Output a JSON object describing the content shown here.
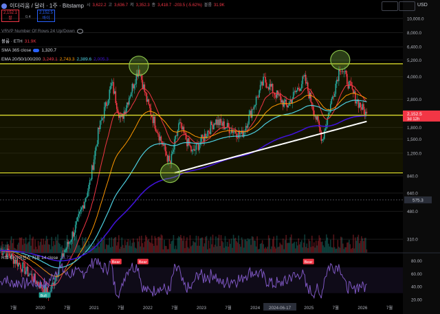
{
  "header": {
    "title": "이더리움 / 달러 · 1주 · Bitstamp",
    "ohlc": [
      {
        "k": "시",
        "v": "3,622.2"
      },
      {
        "k": "고",
        "v": "3,636.7"
      },
      {
        "k": "저",
        "v": "3,352.3"
      },
      {
        "k": "종",
        "v": "3,418.7"
      },
      {
        "k": "",
        "v": "-203.5 (-5.62%)"
      },
      {
        "k": "볼륨",
        "v": "31.9K"
      }
    ],
    "sell": {
      "price": "2,152.1",
      "label": "팔"
    },
    "spread": "0.4",
    "buy": {
      "price": "2,152.5",
      "label": "바이"
    },
    "currency": "USD"
  },
  "indicators": [
    {
      "name": "VRVP Number Of Rows 24 Up/Down",
      "values": []
    },
    {
      "name": "볼륨 · ETH",
      "values": [
        "31.9K"
      ]
    },
    {
      "name": "SMA 365 close",
      "values": [
        "1,320.7"
      ]
    },
    {
      "name": "EMA 20/50/100/200",
      "values": [
        "3,249.1",
        "2,743.3",
        "2,389.6",
        "2,005.3"
      ]
    }
  ],
  "colors": {
    "up": "#26a69a",
    "down": "#f23645",
    "ema20": "#f23645",
    "ema50": "#ff9800",
    "ema100": "#4dd0e1",
    "ema200": "#3f12d6",
    "sma365": "#ffffff",
    "channel": "#d6d62a",
    "rsi": "#7e57c2"
  },
  "chart_data": [
    {
      "type": "line",
      "title": "이더리움 / 달러 · 1주 · Bitstamp",
      "y_scale": "log",
      "ylim": [
        250,
        11000
      ],
      "y_ticks": [
        "10,000.0",
        "8,000.0",
        "6,400.0",
        "5,200.0",
        "4,000.0",
        "2,800.0",
        "2,200.0",
        "1,800.0",
        "1,500.0",
        "1,200.0",
        "840.0",
        "640.0",
        "480.0",
        "310.0"
      ],
      "x_ticks": [
        "7월",
        "2020",
        "7월",
        "2021",
        "7월",
        "2022",
        "7월",
        "2023",
        "7월",
        "2024",
        "2024-06-17",
        "2025",
        "7월",
        "2026",
        "7월"
      ],
      "price_path": [
        [
          "2019-05",
          260
        ],
        [
          "2019-09",
          200
        ],
        [
          "2020-03",
          130
        ],
        [
          "2020-06",
          240
        ],
        [
          "2020-09",
          380
        ],
        [
          "2020-12",
          730
        ],
        [
          "2021-02",
          1700
        ],
        [
          "2021-05",
          3600
        ],
        [
          "2021-07",
          2000
        ],
        [
          "2021-11",
          4600
        ],
        [
          "2022-01",
          2600
        ],
        [
          "2022-06",
          1000
        ],
        [
          "2022-08",
          1900
        ],
        [
          "2022-11",
          1200
        ],
        [
          "2023-04",
          2000
        ],
        [
          "2023-10",
          1600
        ],
        [
          "2024-03",
          3800
        ],
        [
          "2024-08",
          2500
        ],
        [
          "2024-12",
          3900
        ],
        [
          "2025-04",
          1500
        ],
        [
          "2025-08",
          4800
        ],
        [
          "2025-11",
          3000
        ],
        [
          "2026-02",
          2152.5
        ]
      ],
      "ema20_last": 3249.1,
      "ema50_last": 2743.3,
      "ema100_last": 2389.6,
      "ema200_last": 2005.3,
      "sma365_last": 1320.7,
      "channel_lines": [
        4900,
        2180,
        880
      ],
      "price_labels": [
        "2,152.5",
        "3d 12h",
        "575.3"
      ],
      "annotations": [
        "circle top 2021",
        "circle top 2025",
        "circle bottom 2022"
      ]
    },
    {
      "type": "line",
      "title": "RSI 다이버전스 지표 14 close",
      "values_last": "36.72",
      "ylim": [
        20,
        85
      ],
      "y_ticks": [
        "80.00",
        "60.00",
        "40.00",
        "20.00"
      ],
      "labels": [
        {
          "text": "Bull",
          "at": "2020-01"
        },
        {
          "text": "Bear",
          "at": "2021-05"
        },
        {
          "text": "Bear",
          "at": "2021-11"
        },
        {
          "text": "Bear",
          "at": "2024-12"
        }
      ]
    }
  ]
}
